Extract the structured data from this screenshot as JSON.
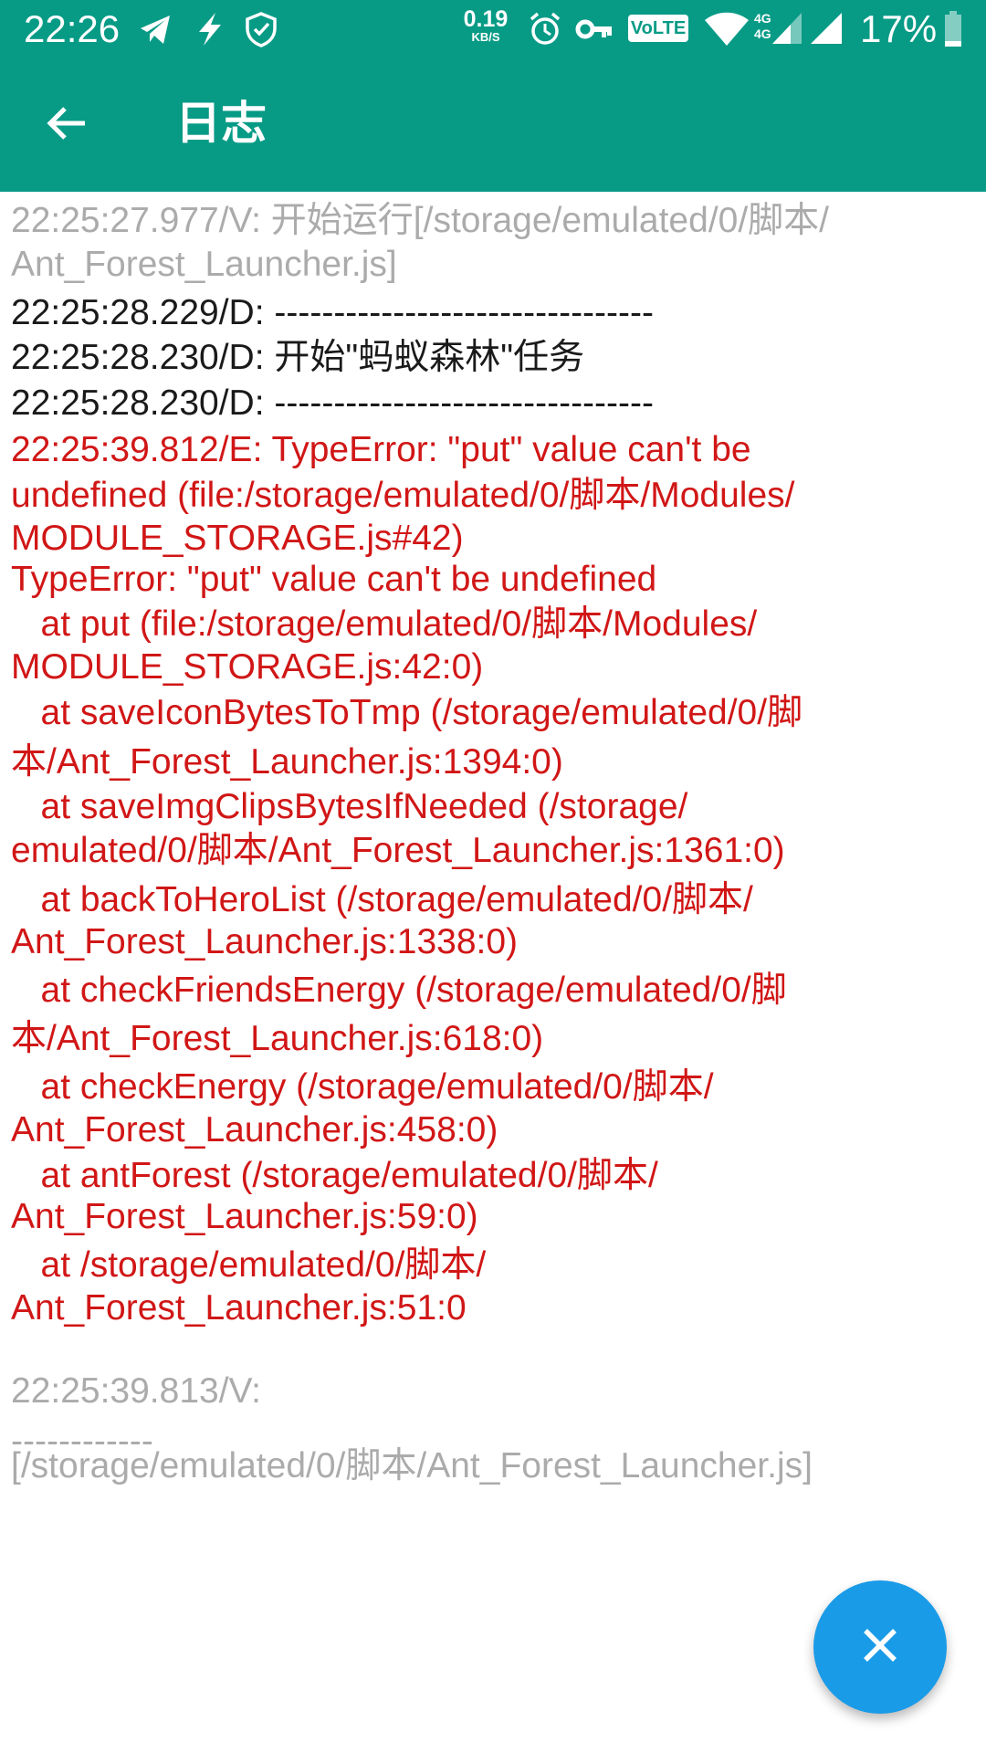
{
  "status_bar": {
    "time": "22:26",
    "net_speed_value": "0.19",
    "net_speed_unit": "KB/S",
    "volte": "VoLTE",
    "network_4g_top": "4G",
    "network_4g_bottom": "4G",
    "battery_percent": "17%",
    "icons": [
      "telegram-icon",
      "flash-icon",
      "shield-check-icon",
      "alarm-icon",
      "key-icon",
      "wifi-icon",
      "signal-icon",
      "battery-icon"
    ]
  },
  "app_bar": {
    "title": "日志",
    "back_icon": "arrow-left-icon",
    "color": "#079b86"
  },
  "log_lines": [
    {
      "text": "22:25:27.977/V: 开始运行[/storage/emulated/0/脚本/",
      "level": "V"
    },
    {
      "text": "Ant_Forest_Launcher.js]",
      "level": "V"
    },
    {
      "text": "22:25:28.229/D: --------------------------------",
      "level": "D"
    },
    {
      "text": "22:25:28.230/D: 开始\"蚂蚁森林\"任务",
      "level": "D"
    },
    {
      "text": "22:25:28.230/D: --------------------------------",
      "level": "D"
    },
    {
      "text": "22:25:39.812/E: TypeError: \"put\" value can't be",
      "level": "E"
    },
    {
      "text": "undefined (file:/storage/emulated/0/脚本/Modules/",
      "level": "E"
    },
    {
      "text": "MODULE_STORAGE.js#42)",
      "level": "E"
    },
    {
      "text": "TypeError: \"put\" value can't be undefined",
      "level": "E"
    },
    {
      "text": "   at put (file:/storage/emulated/0/脚本/Modules/",
      "level": "E"
    },
    {
      "text": "MODULE_STORAGE.js:42:0)",
      "level": "E"
    },
    {
      "text": "   at saveIconBytesToTmp (/storage/emulated/0/脚",
      "level": "E"
    },
    {
      "text": "本/Ant_Forest_Launcher.js:1394:0)",
      "level": "E"
    },
    {
      "text": "   at saveImgClipsBytesIfNeeded (/storage/",
      "level": "E"
    },
    {
      "text": "emulated/0/脚本/Ant_Forest_Launcher.js:1361:0)",
      "level": "E"
    },
    {
      "text": "   at backToHeroList (/storage/emulated/0/脚本/",
      "level": "E"
    },
    {
      "text": "Ant_Forest_Launcher.js:1338:0)",
      "level": "E"
    },
    {
      "text": "   at checkFriendsEnergy (/storage/emulated/0/脚",
      "level": "E"
    },
    {
      "text": "本/Ant_Forest_Launcher.js:618:0)",
      "level": "E"
    },
    {
      "text": "   at checkEnergy (/storage/emulated/0/脚本/",
      "level": "E"
    },
    {
      "text": "Ant_Forest_Launcher.js:458:0)",
      "level": "E"
    },
    {
      "text": "   at antForest (/storage/emulated/0/脚本/",
      "level": "E"
    },
    {
      "text": "Ant_Forest_Launcher.js:59:0)",
      "level": "E"
    },
    {
      "text": "   at /storage/emulated/0/脚本/",
      "level": "E"
    },
    {
      "text": "Ant_Forest_Launcher.js:51:0",
      "level": "E"
    },
    {
      "text": "22:25:39.813/V:",
      "level": "V"
    },
    {
      "text": "------------",
      "level": "V"
    },
    {
      "text": "[/storage/emulated/0/脚本/Ant_Forest_Launcher.js]",
      "level": "V"
    }
  ],
  "colors": {
    "verbose": "#ababab",
    "debug": "#1a1a1a",
    "error": "#d11616",
    "fab": "#1a9be8"
  },
  "fab": {
    "icon": "close-icon"
  }
}
